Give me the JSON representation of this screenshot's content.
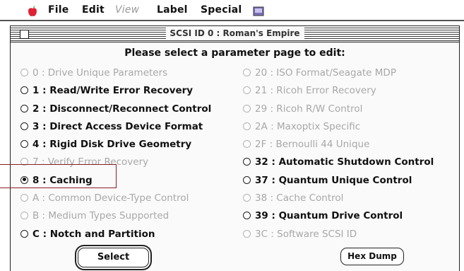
{
  "menubar": {
    "items": [
      "File",
      "Edit",
      "View",
      "Label",
      "Special"
    ]
  },
  "window": {
    "title": "SCSI ID 0 : Roman's Empire",
    "prompt": "Please select a parameter page to edit:"
  },
  "options_left": [
    {
      "label": "0 : Drive Unique Parameters",
      "enabled": false,
      "selected": false
    },
    {
      "label": "1 : Read/Write Error Recovery",
      "enabled": true,
      "selected": false
    },
    {
      "label": "2 : Disconnect/Reconnect Control",
      "enabled": true,
      "selected": false
    },
    {
      "label": "3 : Direct Access Device Format",
      "enabled": true,
      "selected": false
    },
    {
      "label": "4 : Rigid Disk Drive Geometry",
      "enabled": true,
      "selected": false
    },
    {
      "label": "7 : Verify Error Recovery",
      "enabled": false,
      "selected": false
    },
    {
      "label": "8 : Caching",
      "enabled": true,
      "selected": true
    },
    {
      "label": "A : Common Device-Type Control",
      "enabled": false,
      "selected": false
    },
    {
      "label": "B : Medium Types Supported",
      "enabled": false,
      "selected": false
    },
    {
      "label": "C : Notch and Partition",
      "enabled": true,
      "selected": false
    }
  ],
  "options_right": [
    {
      "label": "20 : ISO Format/Seagate MDP",
      "enabled": false,
      "selected": false
    },
    {
      "label": "21 : Ricoh Error Recovery",
      "enabled": false,
      "selected": false
    },
    {
      "label": "29 : Ricoh R/W Control",
      "enabled": false,
      "selected": false
    },
    {
      "label": "2A : Maxoptix Specific",
      "enabled": false,
      "selected": false
    },
    {
      "label": "2F : Bernoulli 44 Unique",
      "enabled": false,
      "selected": false
    },
    {
      "label": "32 : Automatic Shutdown Control",
      "enabled": true,
      "selected": false
    },
    {
      "label": "37 : Quantum Unique Control",
      "enabled": true,
      "selected": false
    },
    {
      "label": "38 : Cache Control",
      "enabled": false,
      "selected": false
    },
    {
      "label": "39 : Quantum Drive Control",
      "enabled": true,
      "selected": false
    },
    {
      "label": "3C : Software SCSI ID",
      "enabled": false,
      "selected": false
    }
  ],
  "buttons": {
    "select": "Select",
    "hex_dump": "Hex Dump"
  }
}
